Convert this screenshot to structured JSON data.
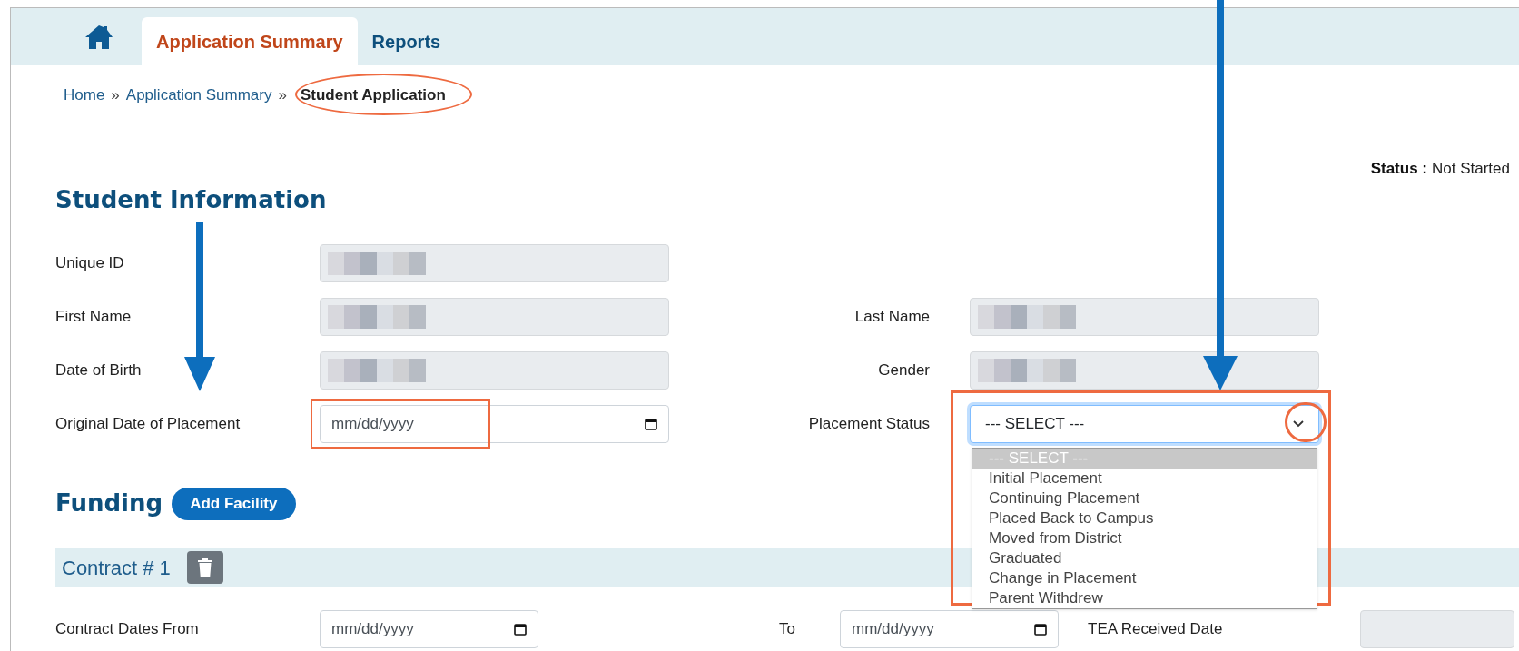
{
  "nav": {
    "tabs": [
      {
        "label": "Application Summary",
        "selected": true
      },
      {
        "label": "Reports",
        "selected": false
      }
    ]
  },
  "breadcrumb": {
    "separator": "»",
    "items": [
      {
        "label": "Home",
        "current": false
      },
      {
        "label": "Application Summary",
        "current": false
      },
      {
        "label": "Student Application",
        "current": true
      }
    ]
  },
  "status": {
    "label": "Status :",
    "value": "Not Started"
  },
  "student_information": {
    "title": "Student Information",
    "rows": [
      {
        "left": {
          "label": "Unique ID",
          "kind": "redacted"
        }
      },
      {
        "left": {
          "label": "First Name",
          "kind": "redacted"
        },
        "right": {
          "label": "Last Name",
          "kind": "redacted"
        }
      },
      {
        "left": {
          "label": "Date of Birth",
          "kind": "redacted"
        },
        "right": {
          "label": "Gender",
          "kind": "redacted"
        }
      },
      {
        "left": {
          "label": "Original Date of Placement",
          "kind": "date",
          "placeholder": "mm/dd/yyyy"
        },
        "right": {
          "label": "Placement Status",
          "kind": "select",
          "value": "--- SELECT ---",
          "expanded": true,
          "options": [
            {
              "label": "--- SELECT ---",
              "selected": true
            },
            {
              "label": "Initial Placement",
              "selected": false
            },
            {
              "label": "Continuing Placement",
              "selected": false
            },
            {
              "label": "Placed Back to Campus",
              "selected": false
            },
            {
              "label": "Moved from District",
              "selected": false
            },
            {
              "label": "Graduated",
              "selected": false
            },
            {
              "label": "Change in Placement",
              "selected": false
            },
            {
              "label": "Parent Withdrew",
              "selected": false
            }
          ]
        }
      }
    ]
  },
  "funding": {
    "title": "Funding",
    "button": "Add Facility"
  },
  "contracts": [
    {
      "title": "Contract # 1",
      "fields": [
        {
          "label": "Contract Dates From",
          "kind": "date",
          "placeholder": "mm/dd/yyyy"
        },
        {
          "label": "To",
          "kind": "date",
          "placeholder": "mm/dd/yyyy"
        },
        {
          "label": "TEA Received Date",
          "kind": "readonly"
        }
      ]
    }
  ]
}
